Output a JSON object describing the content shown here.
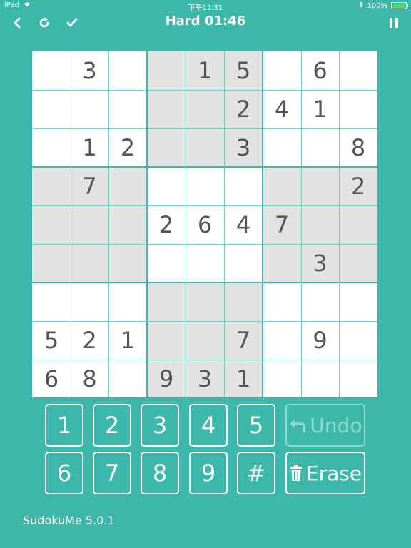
{
  "status_bar": {
    "device": "iPad",
    "time": "下午11:31",
    "battery": "100%"
  },
  "header": {
    "title": "Hard 01:46"
  },
  "icons": {
    "back": "chevron-left-icon",
    "restart": "refresh-icon",
    "check": "checkmark-icon",
    "pause": "pause-icon",
    "undo": "undo-arrow-icon",
    "erase": "trash-icon"
  },
  "board": {
    "rows": [
      [
        "",
        "3",
        "",
        "",
        "1",
        "5",
        "",
        "6",
        ""
      ],
      [
        "",
        "",
        "",
        "",
        "",
        "2",
        "4",
        "1",
        ""
      ],
      [
        "",
        "1",
        "2",
        "",
        "",
        "3",
        "",
        "",
        "8"
      ],
      [
        "",
        "7",
        "",
        "",
        "",
        "",
        "",
        "",
        "2"
      ],
      [
        "",
        "",
        "",
        "2",
        "6",
        "4",
        "7",
        "",
        ""
      ],
      [
        "",
        "",
        "",
        "",
        "",
        "",
        "",
        "3",
        ""
      ],
      [
        "",
        "",
        "",
        "",
        "",
        "",
        "",
        "",
        ""
      ],
      [
        "5",
        "2",
        "1",
        "",
        "",
        "7",
        "",
        "9",
        ""
      ],
      [
        "6",
        "8",
        "",
        "9",
        "3",
        "1",
        "",
        "",
        ""
      ]
    ]
  },
  "keypad": {
    "row1": [
      "1",
      "2",
      "3",
      "4",
      "5"
    ],
    "row2": [
      "6",
      "7",
      "8",
      "9",
      "#"
    ],
    "undo_label": "Undo",
    "erase_label": "Erase"
  },
  "colors": {
    "background": "#3cb8aa",
    "cell_text": "#555555",
    "shaded_box": "#e2e2e2"
  },
  "footer": {
    "version": "SudokuMe 5.0.1"
  }
}
